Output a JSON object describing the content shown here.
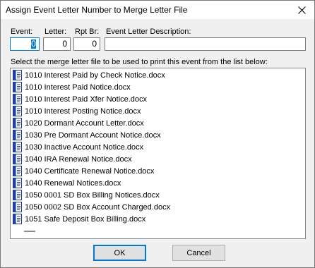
{
  "window": {
    "title": "Assign Event Letter Number to Merge Letter File",
    "close_icon": "close-icon"
  },
  "fields": {
    "event": {
      "label": "Event:",
      "value": "0"
    },
    "letter": {
      "label": "Letter:",
      "value": "0"
    },
    "rpt_br": {
      "label": "Rpt Br:",
      "value": "0"
    },
    "description": {
      "label": "Event Letter Description:",
      "value": ""
    }
  },
  "instruction": "Select the merge letter file to be used to print this event from the list below:",
  "list": {
    "icon": "word-document-icon",
    "items": [
      "1010 Interest Paid by Check Notice.docx",
      "1010 Interest Paid Notice.docx",
      "1010 Interest Paid Xfer Notice.docx",
      "1010 Interest Posting Notice.docx",
      "1020 Dormant Account Letter.docx",
      "1030  Pre Dormant Account Notice.docx",
      "1030 Inactive Account Notice.docx",
      "1040  IRA Renewal Notice.docx",
      "1040 Certificate Renewal Notice.docx",
      "1040 Renewal Notices.docx",
      "1050 0001 SD Box Billing Notices.docx",
      "1050 0002 SD Box Account Charged.docx",
      "1051 Safe Deposit Box Billing.docx"
    ]
  },
  "buttons": {
    "ok": "OK",
    "cancel": "Cancel"
  }
}
